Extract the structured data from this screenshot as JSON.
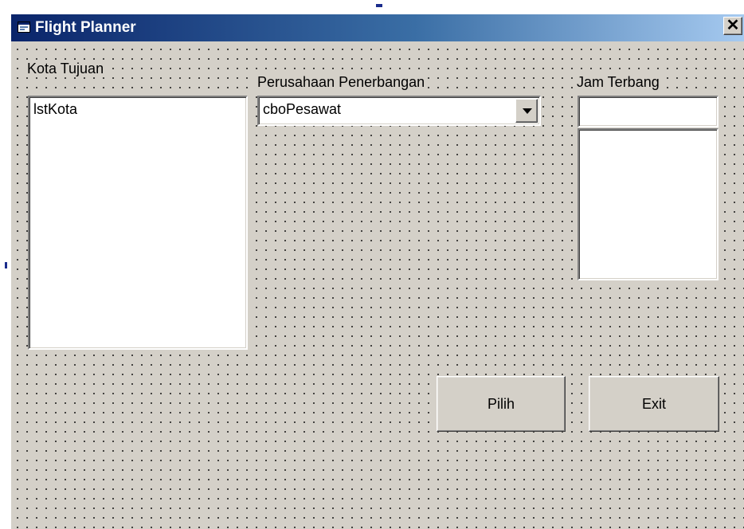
{
  "window": {
    "title": "Flight Planner",
    "title_icon": "form-icon",
    "close_glyph": "✕"
  },
  "labels": {
    "kota_tujuan": "Kota Tujuan",
    "perusahaan": "Perusahaan Penerbangan",
    "jam_terbang": "Jam Terbang"
  },
  "controls": {
    "list_kota": "lstKota",
    "combo_pesawat": "cboPesawat",
    "jam_text": ""
  },
  "buttons": {
    "pilih": "Pilih",
    "exit": "Exit"
  },
  "colors": {
    "titlebar_start": "#0a246a",
    "titlebar_end": "#a6caf0",
    "face": "#d4d0c8"
  }
}
